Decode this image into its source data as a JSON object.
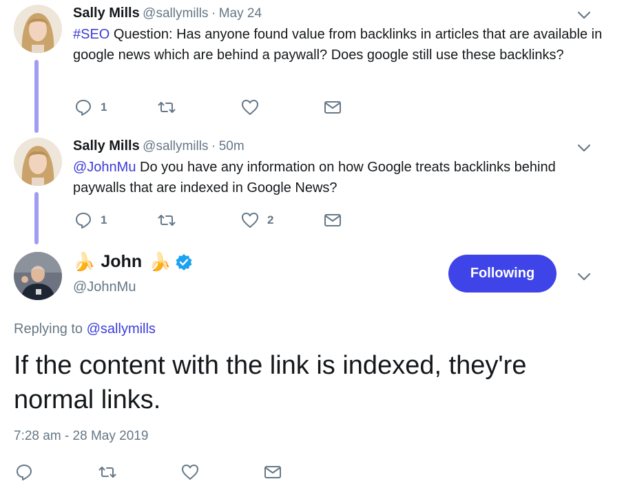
{
  "tweets": [
    {
      "author": "Sally Mills",
      "handle": "@sallymills",
      "sep": "·",
      "time": "May 24",
      "hashtag": "#SEO",
      "text": " Question: Has anyone found value from backlinks in articles that are available in google news which are behind a paywall? Does google still use these backlinks?",
      "reply_count": "1",
      "like_count": ""
    },
    {
      "author": "Sally Mills",
      "handle": "@sallymills",
      "sep": "·",
      "time": "50m",
      "mention": "@JohnMu",
      "text": " Do you have any information on how Google treats backlinks behind paywalls that are indexed in Google News?",
      "reply_count": "1",
      "like_count": "2"
    }
  ],
  "main": {
    "name": "John",
    "name_emoji": "🍌",
    "handle": "@JohnMu",
    "follow_label": "Following",
    "replying_prefix": "Replying to",
    "replying_to": "@sallymills",
    "text": "If the content with the link is indexed, they're normal links.",
    "timestamp": "7:28 am - 28 May 2019"
  },
  "colors": {
    "accent": "#3f44e8",
    "link": "#3b3bd9",
    "thread_line": "#9f9cf2",
    "muted": "#657786",
    "verified": "#1da1f2"
  },
  "icons": {
    "reply": "reply-icon",
    "retweet": "retweet-icon",
    "like": "heart-icon",
    "dm": "envelope-icon",
    "more": "chevron-down-icon",
    "verified": "verified-badge-icon"
  }
}
